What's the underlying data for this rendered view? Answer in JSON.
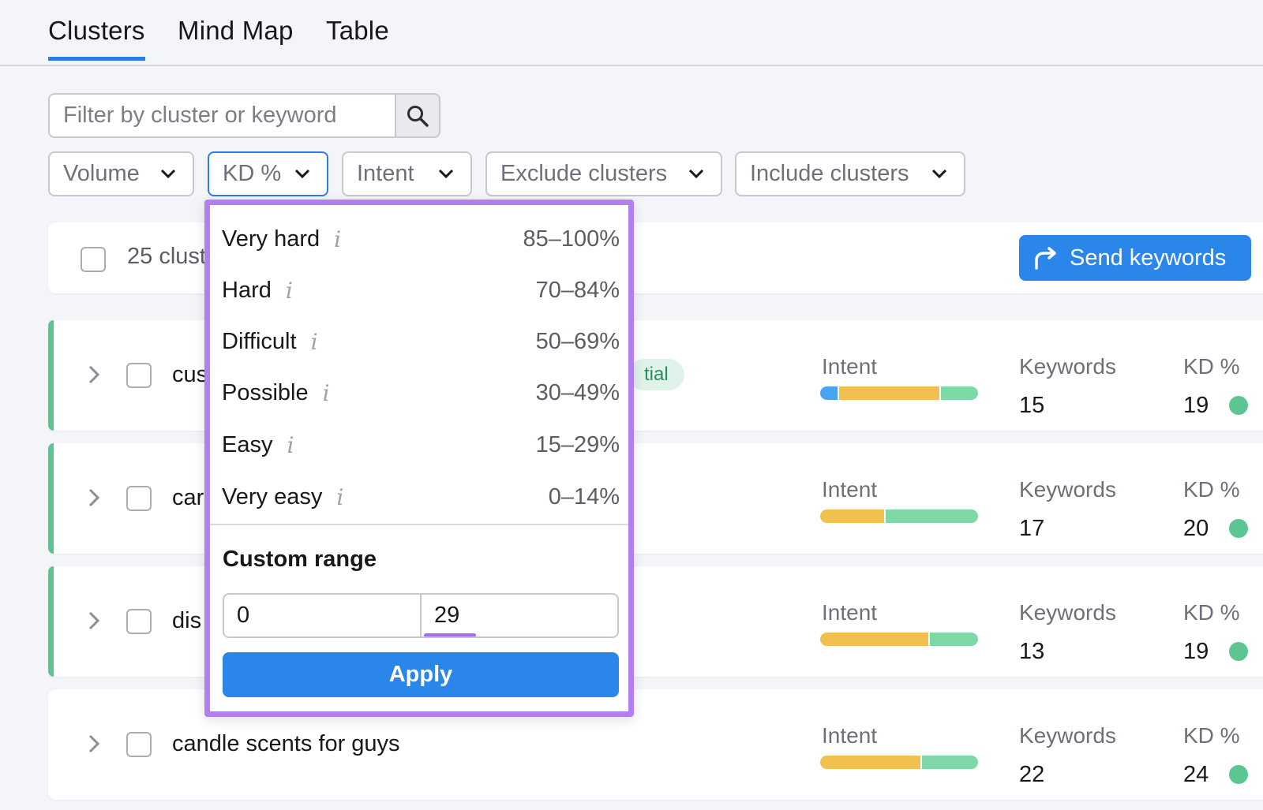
{
  "tabs": [
    "Clusters",
    "Mind Map",
    "Table"
  ],
  "active_tab": "Clusters",
  "search": {
    "placeholder": "Filter by cluster or keyword"
  },
  "filters": {
    "volume": "Volume",
    "kd": "KD %",
    "intent": "Intent",
    "exclude": "Exclude clusters",
    "include": "Include clusters"
  },
  "toolbar": {
    "count_text": "25 clust",
    "send_label": "Send keywords"
  },
  "kd_dropdown": {
    "options": [
      {
        "label": "Very hard",
        "range": "85–100%"
      },
      {
        "label": "Hard",
        "range": "70–84%"
      },
      {
        "label": "Difficult",
        "range": "50–69%"
      },
      {
        "label": "Possible",
        "range": "30–49%"
      },
      {
        "label": "Easy",
        "range": "15–29%"
      },
      {
        "label": "Very easy",
        "range": "0–14%"
      }
    ],
    "info_glyph": "i",
    "custom_range_title": "Custom range",
    "range_from": "0",
    "range_to": "29",
    "apply_label": "Apply"
  },
  "labels": {
    "intent": "Intent",
    "keywords": "Keywords",
    "kd": "KD %"
  },
  "clusters": [
    {
      "name": "cus",
      "pill": "tial",
      "keywords": "15",
      "kd": "19",
      "intent_mix": {
        "blue": 0.11,
        "yellow": 0.65,
        "green": 0.24
      }
    },
    {
      "name": "car",
      "pill": "",
      "keywords": "17",
      "kd": "20",
      "intent_mix": {
        "blue": 0,
        "yellow": 0.41,
        "green": 0.59
      }
    },
    {
      "name": "dis",
      "pill": "",
      "keywords": "13",
      "kd": "19",
      "intent_mix": {
        "blue": 0,
        "yellow": 0.69,
        "green": 0.31
      }
    },
    {
      "name": "candle scents for guys",
      "pill": "",
      "keywords": "22",
      "kd": "24",
      "intent_mix": {
        "blue": 0,
        "yellow": 0.64,
        "green": 0.36
      }
    }
  ],
  "colors": {
    "accent": "#2b86ea",
    "popup_border": "#b37ff0",
    "kd_dot": "#5cc693"
  }
}
